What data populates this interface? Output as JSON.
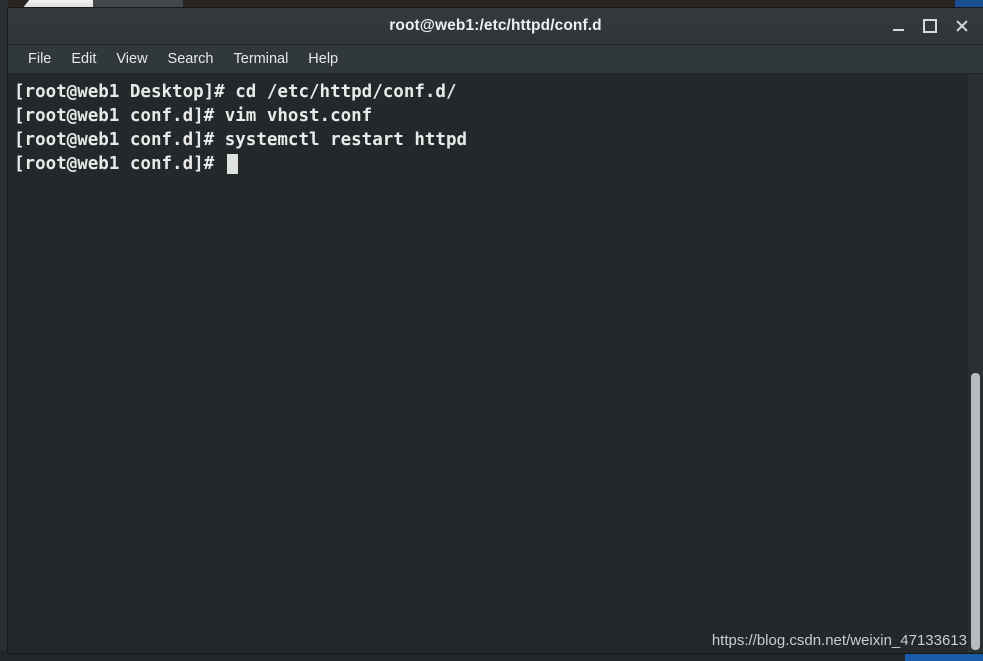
{
  "window": {
    "title": "root@web1:/etc/httpd/conf.d",
    "controls": {
      "minimize_label": "Minimize",
      "maximize_label": "Maximize",
      "close_label": "Close"
    }
  },
  "menu": {
    "items": [
      {
        "label": "File"
      },
      {
        "label": "Edit"
      },
      {
        "label": "View"
      },
      {
        "label": "Search"
      },
      {
        "label": "Terminal"
      },
      {
        "label": "Help"
      }
    ]
  },
  "terminal": {
    "lines": [
      "[root@web1 Desktop]# cd /etc/httpd/conf.d/",
      "[root@web1 conf.d]# vim vhost.conf",
      "[root@web1 conf.d]# systemctl restart httpd"
    ],
    "prompt": "[root@web1 conf.d]# ",
    "cursor": "block"
  },
  "watermark": {
    "text": "https://blog.csdn.net/weixin_47133613"
  },
  "colors": {
    "terminal_background": "#24282b",
    "terminal_foreground": "#e8eaea",
    "titlebar_background": "#2f3436",
    "menubar_background": "#31383b",
    "scrollbar_thumb": "#b7bcbc",
    "accent_blue": "#1a5caa"
  }
}
